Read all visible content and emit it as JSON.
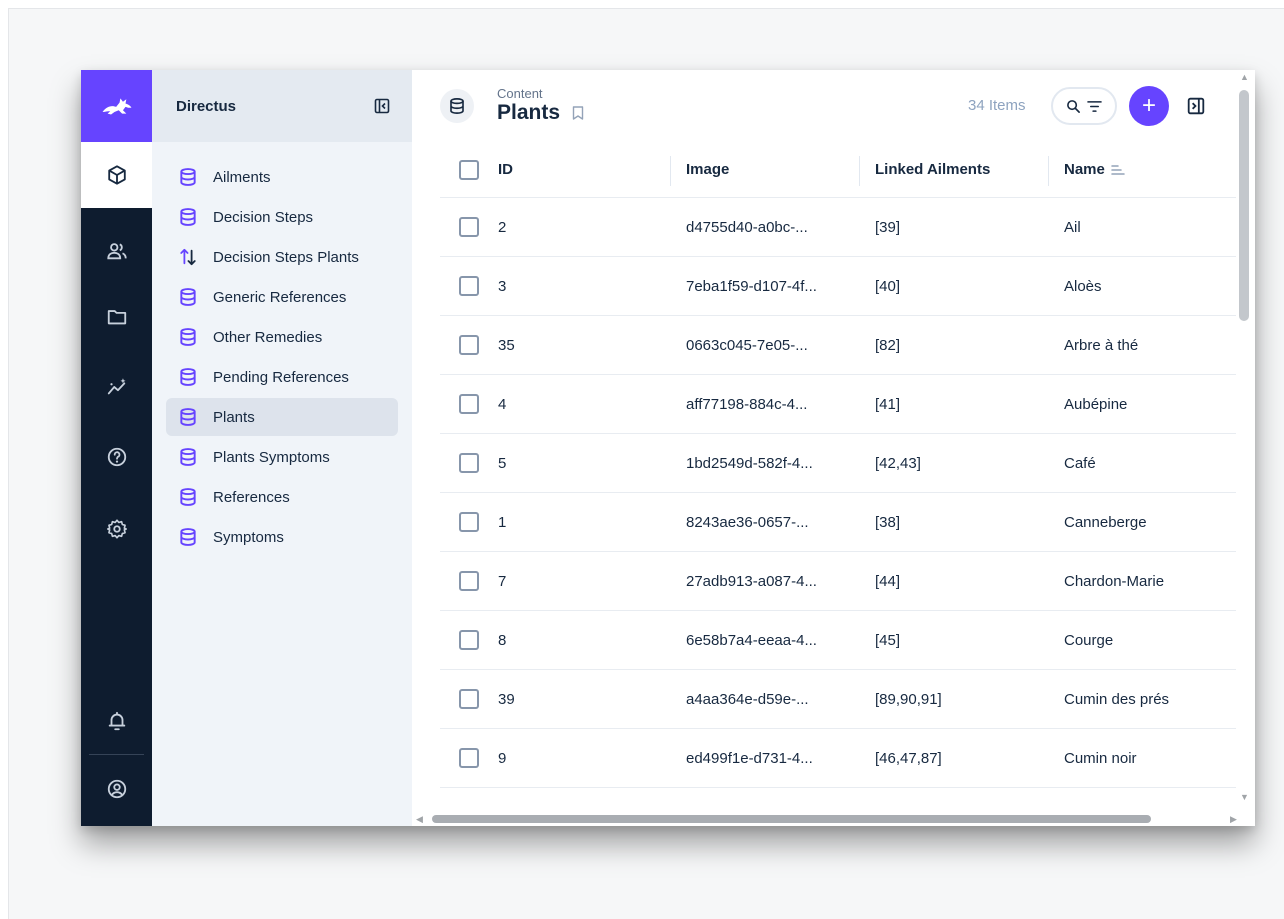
{
  "app": {
    "project_name": "Directus",
    "accent_color": "#6644ff",
    "modulebar_color": "#0e1c2f"
  },
  "modules": [
    {
      "name": "content",
      "icon": "box-icon",
      "active": true
    },
    {
      "name": "users",
      "icon": "users-icon",
      "active": false
    },
    {
      "name": "files",
      "icon": "folder-icon",
      "active": false
    },
    {
      "name": "insights",
      "icon": "insights-icon",
      "active": false
    },
    {
      "name": "help",
      "icon": "help-icon",
      "active": false
    },
    {
      "name": "settings",
      "icon": "gear-icon",
      "active": false
    },
    {
      "name": "notifications",
      "icon": "bell-icon",
      "active": false
    },
    {
      "name": "account",
      "icon": "account-icon",
      "active": false
    }
  ],
  "navigation": {
    "items": [
      {
        "label": "Ailments",
        "icon": "database-icon"
      },
      {
        "label": "Decision Steps",
        "icon": "database-icon"
      },
      {
        "label": "Decision Steps Plants",
        "icon": "import-export-icon"
      },
      {
        "label": "Generic References",
        "icon": "database-icon"
      },
      {
        "label": "Other Remedies",
        "icon": "database-icon"
      },
      {
        "label": "Pending References",
        "icon": "database-icon"
      },
      {
        "label": "Plants",
        "icon": "database-icon",
        "active": true
      },
      {
        "label": "Plants Symptoms",
        "icon": "database-icon"
      },
      {
        "label": "References",
        "icon": "database-icon"
      },
      {
        "label": "Symptoms",
        "icon": "database-icon"
      }
    ]
  },
  "header": {
    "breadcrumb": "Content",
    "title": "Plants",
    "item_count": "34 Items",
    "add_label": "+"
  },
  "table": {
    "columns": [
      "ID",
      "Image",
      "Linked Ailments",
      "Name"
    ],
    "rows": [
      {
        "id": "2",
        "image": "d4755d40-a0bc-...",
        "linked": "[39]",
        "name": "Ail"
      },
      {
        "id": "3",
        "image": "7eba1f59-d107-4f...",
        "linked": "[40]",
        "name": "Aloès"
      },
      {
        "id": "35",
        "image": "0663c045-7e05-...",
        "linked": "[82]",
        "name": "Arbre à thé"
      },
      {
        "id": "4",
        "image": "aff77198-884c-4...",
        "linked": "[41]",
        "name": "Aubépine"
      },
      {
        "id": "5",
        "image": "1bd2549d-582f-4...",
        "linked": "[42,43]",
        "name": "Café"
      },
      {
        "id": "1",
        "image": "8243ae36-0657-...",
        "linked": "[38]",
        "name": "Canneberge"
      },
      {
        "id": "7",
        "image": "27adb913-a087-4...",
        "linked": "[44]",
        "name": "Chardon-Marie"
      },
      {
        "id": "8",
        "image": "6e58b7a4-eeaa-4...",
        "linked": "[45]",
        "name": "Courge"
      },
      {
        "id": "39",
        "image": "a4aa364e-d59e-...",
        "linked": "[89,90,91]",
        "name": "Cumin des prés"
      },
      {
        "id": "9",
        "image": "ed499f1e-d731-4...",
        "linked": "[46,47,87]",
        "name": "Cumin noir"
      }
    ]
  }
}
